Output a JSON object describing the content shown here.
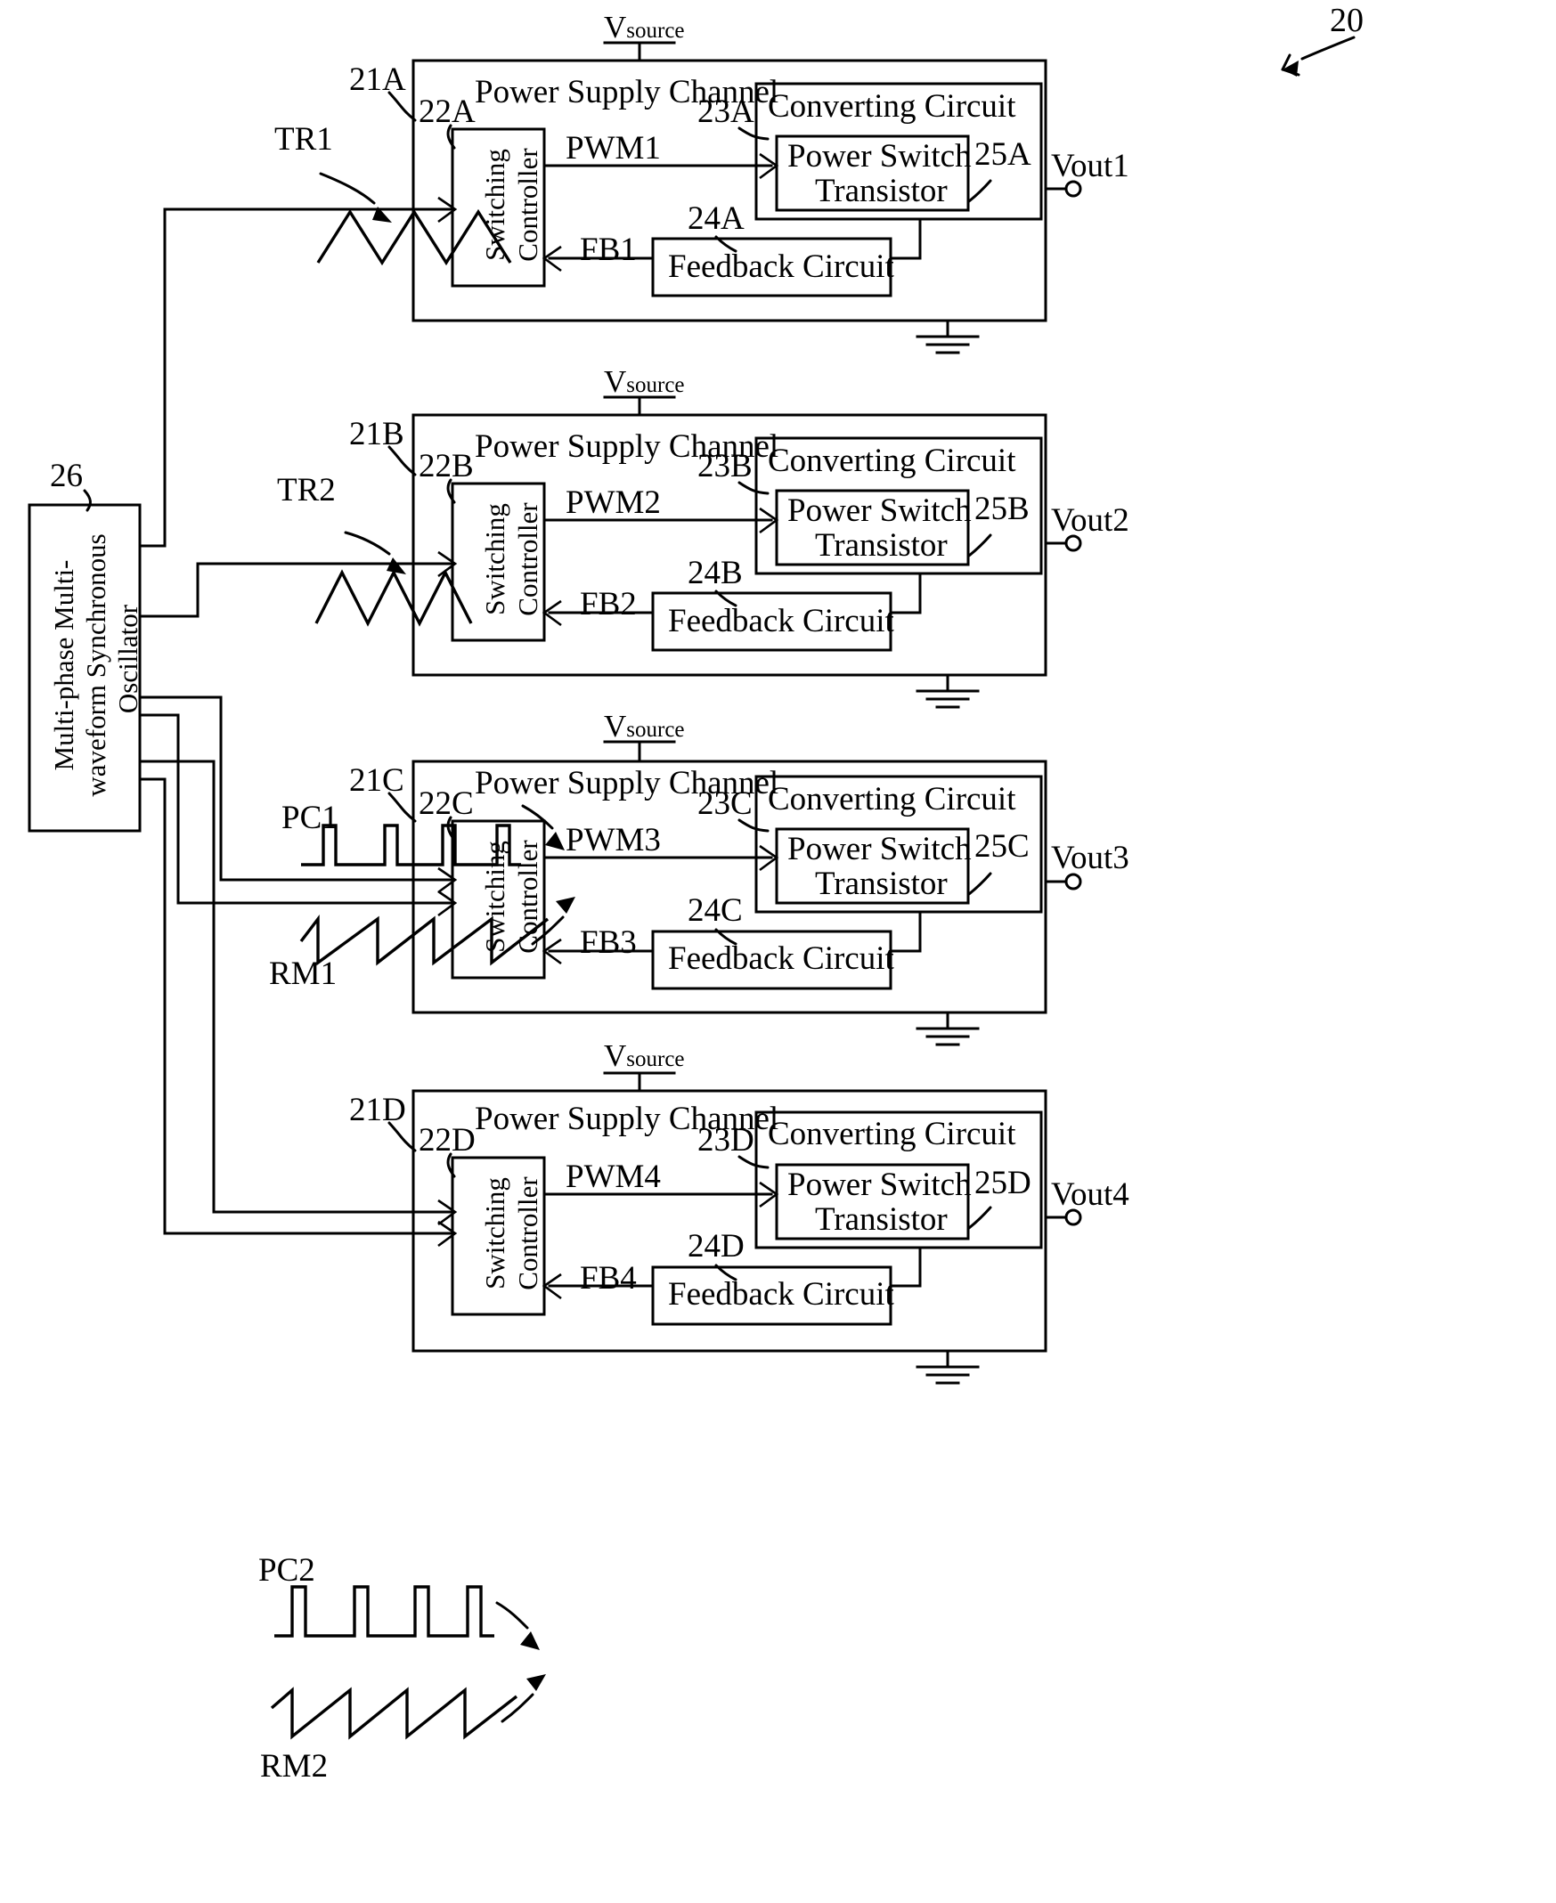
{
  "figure": {
    "ref_number": "20",
    "oscillator": {
      "ref": "26",
      "line1": "Multi-phase Multi-",
      "line2": "waveform Synchronous",
      "line3": "Oscillator",
      "full_label": "Multi-phase Multi-waveform Synchronous Oscillator"
    },
    "common_labels": {
      "vsource": "V",
      "vsource_sub": "source",
      "power_supply_channel": "Power Supply Channel",
      "switching_controller_line1": "Switching",
      "switching_controller_line2": "Controller",
      "converting_circuit": "Converting Circuit",
      "power_switch_line1": "Power Switch",
      "power_switch_line2": "Transistor",
      "feedback_circuit": "Feedback Circuit"
    },
    "channels": [
      {
        "id": "A",
        "channel_ref": "21A",
        "controller_ref": "22A",
        "converting_ref": "23A",
        "feedback_ref": "24A",
        "output_ref": "25A",
        "pwm_label": "PWM1",
        "fb_label": "FB1",
        "vout_label": "Vout1",
        "input_waveforms": [
          {
            "name": "TR1",
            "type": "triangle",
            "cycles": 3
          }
        ]
      },
      {
        "id": "B",
        "channel_ref": "21B",
        "controller_ref": "22B",
        "converting_ref": "23B",
        "feedback_ref": "24B",
        "output_ref": "25B",
        "pwm_label": "PWM2",
        "fb_label": "FB2",
        "vout_label": "Vout2",
        "input_waveforms": [
          {
            "name": "TR2",
            "type": "triangle",
            "cycles": 3
          }
        ]
      },
      {
        "id": "C",
        "channel_ref": "21C",
        "controller_ref": "22C",
        "converting_ref": "23C",
        "feedback_ref": "24C",
        "output_ref": "25C",
        "pwm_label": "PWM3",
        "fb_label": "FB3",
        "vout_label": "Vout3",
        "input_waveforms": [
          {
            "name": "PC1",
            "type": "pulse",
            "cycles": 4
          },
          {
            "name": "RM1",
            "type": "ramp",
            "cycles": 4
          }
        ]
      },
      {
        "id": "D",
        "channel_ref": "21D",
        "controller_ref": "22D",
        "converting_ref": "23D",
        "feedback_ref": "24D",
        "output_ref": "25D",
        "pwm_label": "PWM4",
        "fb_label": "FB4",
        "vout_label": "Vout4",
        "input_waveforms": [
          {
            "name": "PC2",
            "type": "pulse",
            "cycles": 4
          },
          {
            "name": "RM2",
            "type": "ramp",
            "cycles": 4
          }
        ]
      }
    ]
  },
  "colors": {
    "ink": "#000000",
    "paper": "#ffffff"
  }
}
